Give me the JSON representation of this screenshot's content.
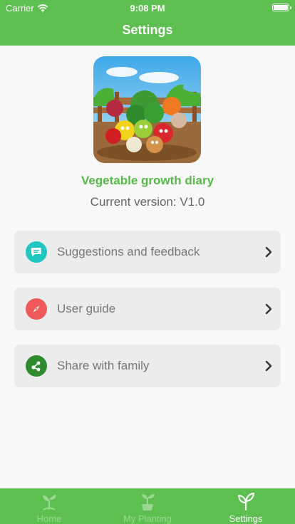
{
  "status": {
    "carrier": "Carrier",
    "time": "9:08 PM"
  },
  "nav": {
    "title": "Settings"
  },
  "app": {
    "name": "Vegetable growth diary",
    "version": "Current version: V1.0"
  },
  "menu": [
    {
      "label": "Suggestions and feedback",
      "icon": "chat-icon",
      "color": "#1fc7c0"
    },
    {
      "label": "User guide",
      "icon": "compass-icon",
      "color": "#f0585a"
    },
    {
      "label": "Share with family",
      "icon": "share-icon",
      "color": "#2e8b2e"
    }
  ],
  "tabs": [
    {
      "label": "Home",
      "icon": "sprout-icon",
      "active": false
    },
    {
      "label": "My Planting",
      "icon": "potted-plant-icon",
      "active": false
    },
    {
      "label": "Settings",
      "icon": "leaf-icon",
      "active": true
    }
  ],
  "colors": {
    "primary": "#5cbf50",
    "accent_text": "#55b948",
    "row_bg": "#ececec"
  }
}
